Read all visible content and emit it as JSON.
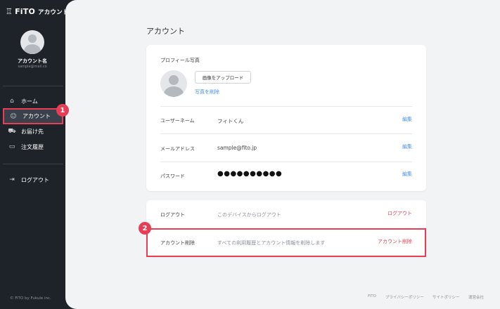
{
  "sidebar": {
    "logo_text": "FiTO",
    "logo_sub": "アカウント",
    "account_name": "アカウント名",
    "account_email": "sample@mail.co",
    "nav": [
      {
        "label": "ホーム",
        "icon": "home-icon"
      },
      {
        "label": "アカウント",
        "icon": "users-icon",
        "active": true
      },
      {
        "label": "お届け先",
        "icon": "truck-icon"
      },
      {
        "label": "注文履歴",
        "icon": "card-icon"
      }
    ],
    "logout_label": "ログアウト",
    "copyright": "© FiTO by Fukule inc."
  },
  "badges": {
    "first": "1",
    "second": "2"
  },
  "main": {
    "title": "アカウント",
    "profile": {
      "photo_label": "プロフィール写真",
      "upload_button": "画像をアップロード",
      "delete_photo": "写真を削除"
    },
    "rows": [
      {
        "label": "ユーザーネーム",
        "value": "フィトくん",
        "edit": "編集"
      },
      {
        "label": "メールアドレス",
        "value": "sample@fito.jp",
        "edit": "編集"
      },
      {
        "label": "パスワード",
        "value": "●●●●●●●●●●",
        "edit": "編集"
      }
    ],
    "actions": [
      {
        "label": "ログアウト",
        "desc": "このデバイスからログアウト",
        "action": "ログアウト"
      },
      {
        "label": "アカウント削除",
        "desc": "すべての利用履歴とアカウント情報を削除します",
        "action": "アカウント削除"
      }
    ]
  },
  "footer": {
    "links": [
      "FiTO",
      "プライバシーポリシー",
      "サイトポリシー",
      "運営会社"
    ]
  },
  "colors": {
    "accent": "#e63e55",
    "link": "#4a90e2",
    "sidebar": "#1e2329"
  }
}
